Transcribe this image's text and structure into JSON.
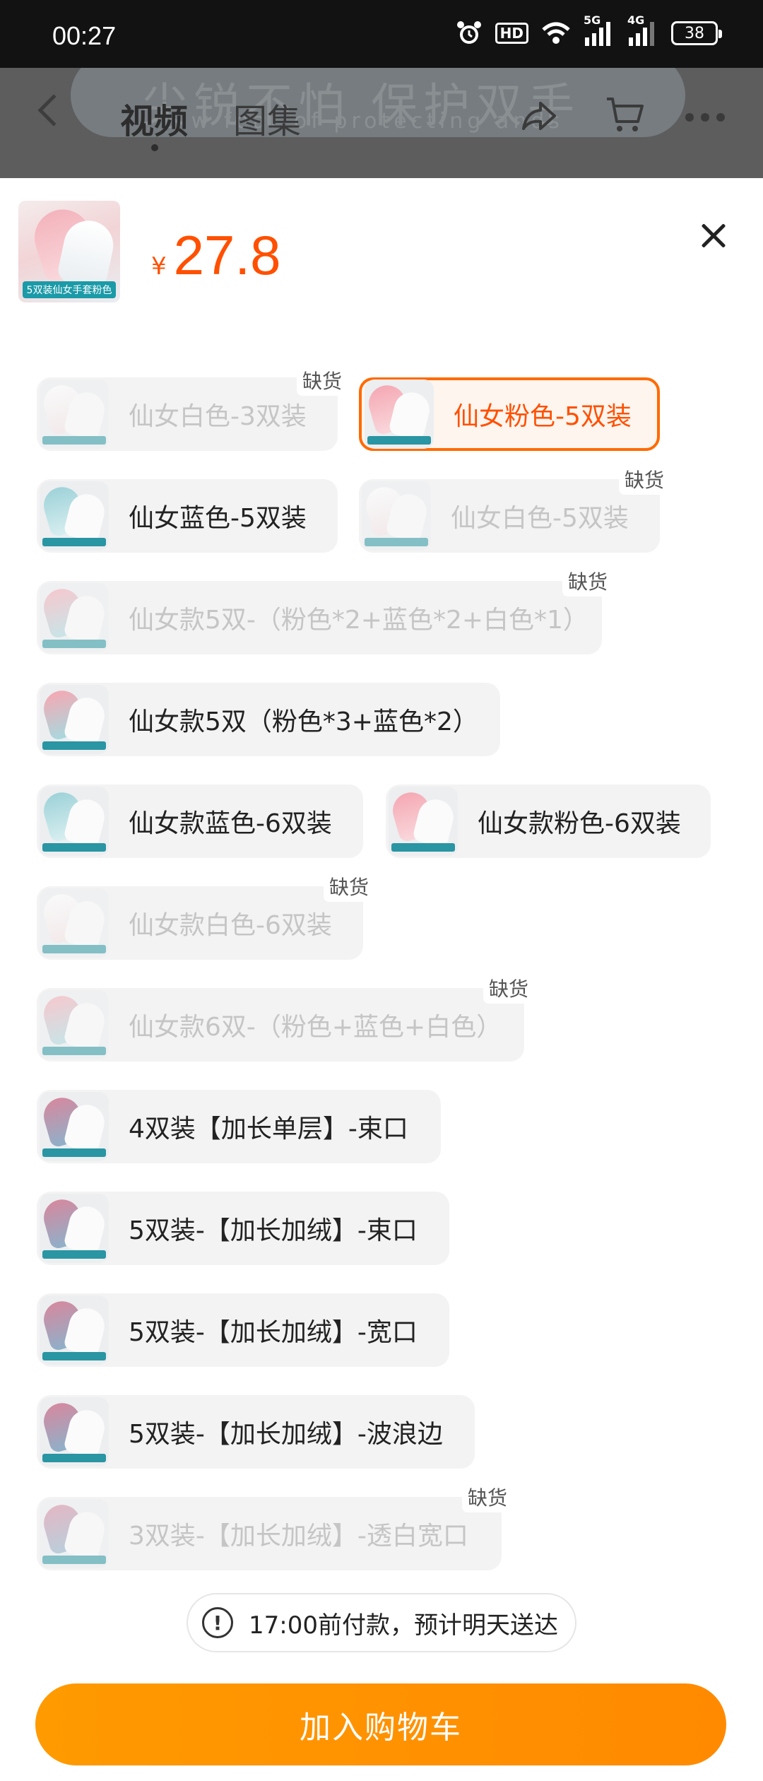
{
  "status_bar": {
    "time": "00:27",
    "hd_label": "HD",
    "net_5g": "5G",
    "net_4g": "4G",
    "battery": "38"
  },
  "header": {
    "banner_text": "尖锐不怕 保护双手",
    "banner_sub": "p w fear of protecting ands",
    "tabs": [
      "视频",
      "图集"
    ]
  },
  "product": {
    "thumb_tag": "5双装仙女手套粉色",
    "currency": "¥",
    "price": "27.8"
  },
  "oos_label": "缺货",
  "options": [
    {
      "label": "仙女白色-3双装",
      "state": "disabled",
      "thumb": "white-pink"
    },
    {
      "label": "仙女粉色-5双装",
      "state": "selected",
      "thumb": "pink"
    },
    {
      "label": "仙女蓝色-5双装",
      "state": "normal",
      "thumb": "blue"
    },
    {
      "label": "仙女白色-5双装",
      "state": "disabled",
      "thumb": "white-pink"
    },
    {
      "label": "仙女款5双-（粉色*2+蓝色*2+白色*1）",
      "state": "disabled",
      "thumb": "pink-blue"
    },
    {
      "label": "仙女款5双（粉色*3+蓝色*2）",
      "state": "normal",
      "thumb": "pink-blue"
    },
    {
      "label": "仙女款蓝色-6双装",
      "state": "normal",
      "thumb": "blue"
    },
    {
      "label": "仙女款粉色-6双装",
      "state": "normal",
      "thumb": "pink"
    },
    {
      "label": "仙女款白色-6双装",
      "state": "disabled",
      "thumb": "white-pink"
    },
    {
      "label": "仙女款6双-（粉色+蓝色+白色）",
      "state": "disabled",
      "thumb": "pink-blue"
    },
    {
      "label": "4双装【加长单层】-束口",
      "state": "normal",
      "thumb": "long"
    },
    {
      "label": "5双装-【加长加绒】-束口",
      "state": "normal",
      "thumb": "long"
    },
    {
      "label": "5双装-【加长加绒】-宽口",
      "state": "normal",
      "thumb": "long"
    },
    {
      "label": "5双装-【加长加绒】-波浪边",
      "state": "normal",
      "thumb": "long"
    },
    {
      "label": "3双装-【加长加绒】-透白宽口",
      "state": "disabled",
      "thumb": "long"
    }
  ],
  "delivery": {
    "icon": "exclamation-icon",
    "text": "17:00前付款，预计明天送达"
  },
  "add_to_cart": "加入购物车",
  "colors": {
    "accent": "#ff5000",
    "button": "#ff9000",
    "selected_border": "#ff6a00"
  }
}
